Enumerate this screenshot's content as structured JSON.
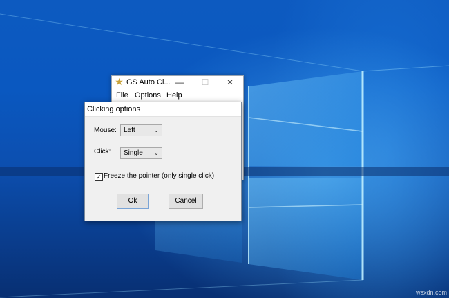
{
  "main_window": {
    "title": "GS Auto Cl...",
    "controls": {
      "minimize": "—",
      "maximize": "☐",
      "close": "✕"
    },
    "menu": [
      "File",
      "Options",
      "Help"
    ]
  },
  "dialog": {
    "title": "Clicking options",
    "mouse_label": "Mouse:",
    "mouse_value": "Left",
    "click_label": "Click:",
    "click_value": "Single",
    "freeze_checked": true,
    "freeze_label": "Freeze the pointer (only single click)",
    "ok_label": "Ok",
    "cancel_label": "Cancel"
  },
  "icons": {
    "app": "star-icon",
    "dropdown": "chevron-down-icon",
    "check": "checkmark-icon"
  },
  "watermark": "wsxdn.com",
  "colors": {
    "desktop_blue": "#0a58c0",
    "window_bg": "#ffffff",
    "dialog_bg": "#f0f0f0"
  }
}
